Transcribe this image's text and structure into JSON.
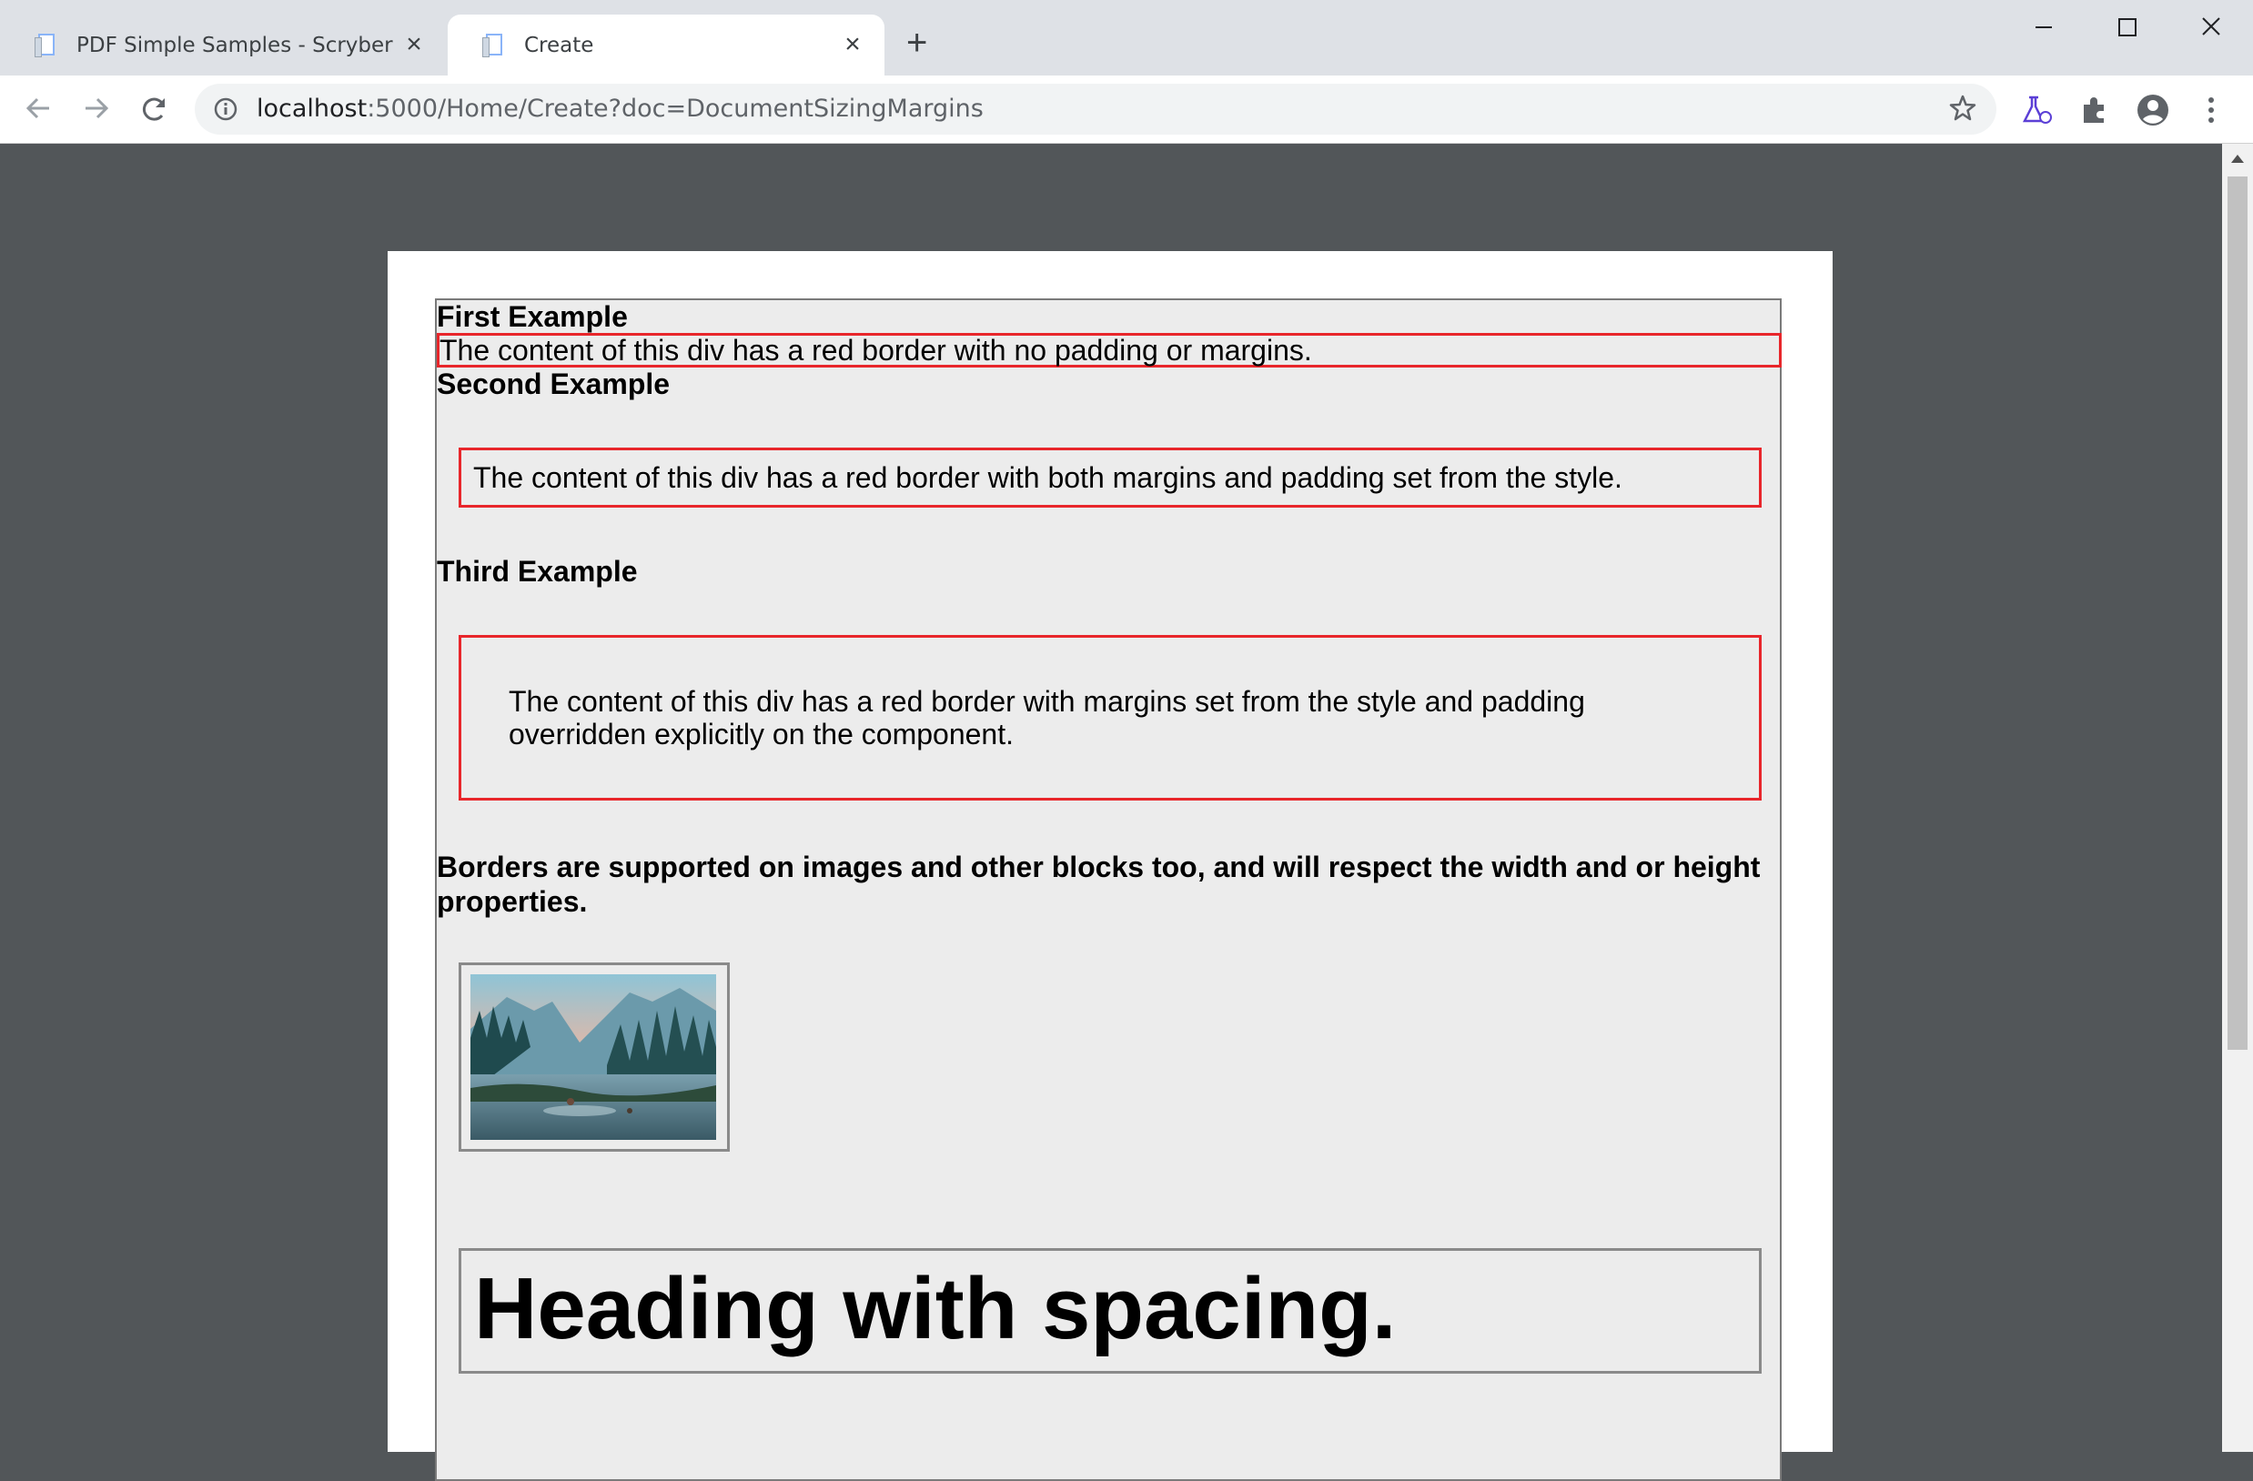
{
  "browser": {
    "tabs": [
      {
        "label": "PDF Simple Samples - Scryber",
        "active": false
      },
      {
        "label": "Create",
        "active": true
      }
    ],
    "new_tab_label": "+",
    "url_host": "localhost",
    "url_rest": ":5000/Home/Create?doc=DocumentSizingMargins"
  },
  "document": {
    "first_heading": "First Example",
    "first_text": "The content of this div has a red border with no padding or margins.",
    "second_heading": "Second Example",
    "second_text": "The content of this div has a red border with both margins and padding set from the style.",
    "third_heading": "Third Example",
    "third_text_line1": "The content of this div has a red border with margins set from the style and padding",
    "third_text_line2": "overridden explicitly on the component.",
    "borders_line1": "Borders are supported on images and other blocks too, and will respect the width and or height",
    "borders_line2": "properties.",
    "big_heading": "Heading with spacing."
  },
  "colors": {
    "chrome_bg": "#dee1e6",
    "viewer_bg": "#525659",
    "red_border": "#e8262b",
    "page_fill": "#ececec"
  },
  "icons": [
    "back-icon",
    "forward-icon",
    "reload-icon",
    "info-icon",
    "star-icon",
    "labs-icon",
    "extensions-icon",
    "profile-icon",
    "menu-icon",
    "minimize-icon",
    "maximize-icon",
    "close-window-icon"
  ]
}
